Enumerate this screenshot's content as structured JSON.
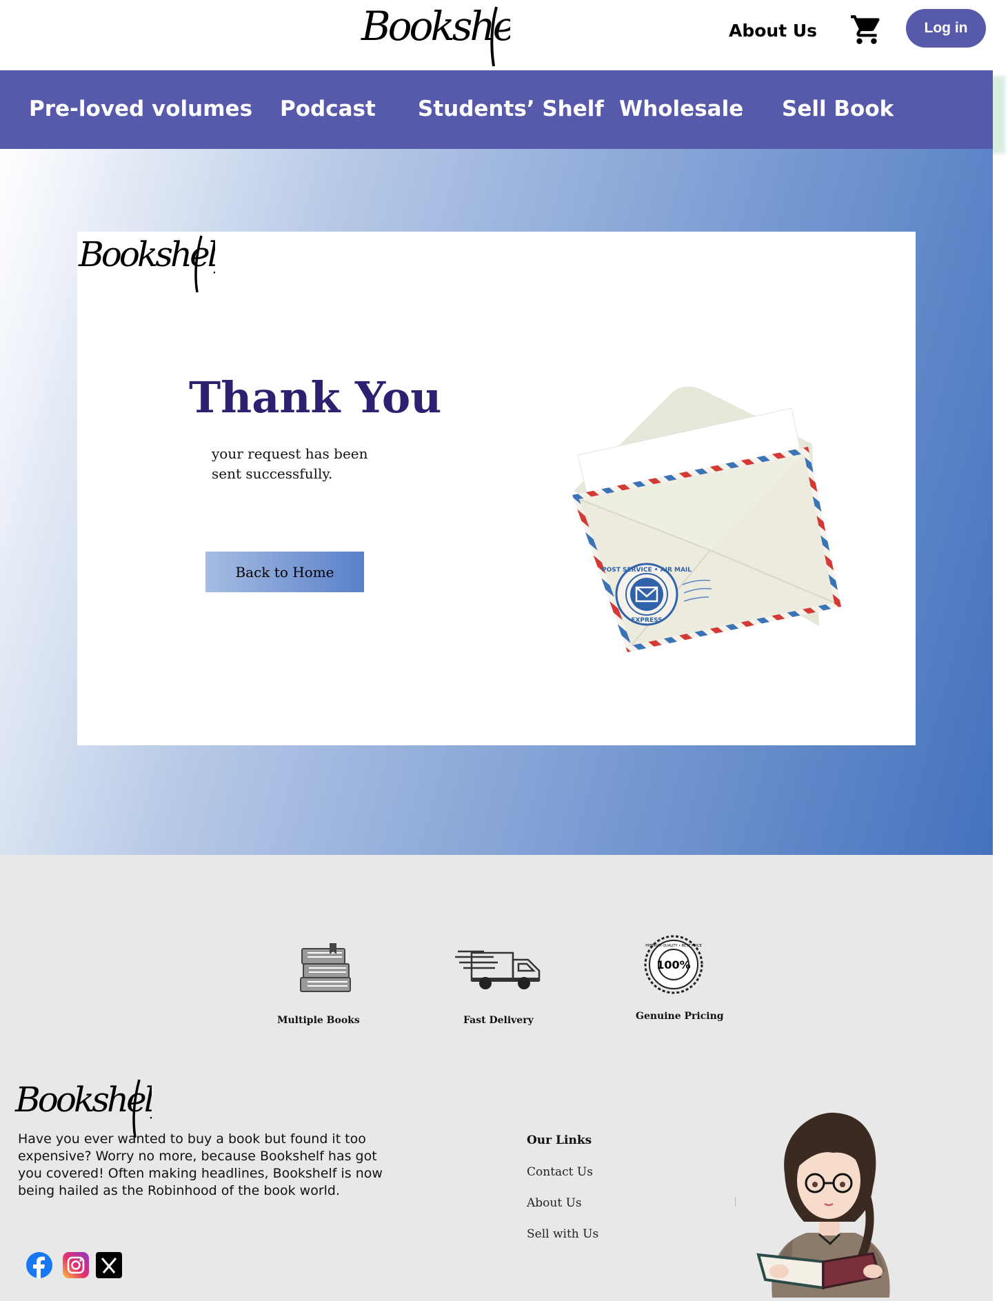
{
  "header": {
    "logo_text": "Bookshelf",
    "about_label": "About Us",
    "cart_icon": "cart-icon",
    "login_label": "Log in"
  },
  "nav": {
    "items": [
      {
        "label": "Pre-loved volumes"
      },
      {
        "label": "Podcast"
      },
      {
        "label": "Students’ Shelf"
      },
      {
        "label": "Wholesale"
      },
      {
        "label": "Sell Book"
      }
    ]
  },
  "hero": {
    "logo_text": "Bookshelf",
    "title": "Thank You",
    "message": "your request has been sent successfully.",
    "back_button": "Back to Home",
    "stamp_text_top": "POST SERVICE • AIR MAIL",
    "stamp_text_bottom": "EXPRESS"
  },
  "features": [
    {
      "icon": "books-stack-icon",
      "label": "Multiple Books"
    },
    {
      "icon": "delivery-truck-icon",
      "label": "Fast Delivery"
    },
    {
      "icon": "quality-seal-icon",
      "label": "Genuine Pricing",
      "seal_text": "100%",
      "seal_ring": "PREMIUM QUALITY • BEST PRICE"
    }
  ],
  "footer": {
    "logo_text": "Bookshelf",
    "description": "Have you ever wanted to buy a book but found it too expensive? Worry no more, because Bookshelf has got you covered! Often making headlines, Bookshelf is now being hailed as the Robinhood of the book world.",
    "links_title": "Our Links",
    "links": [
      {
        "label": "Contact Us"
      },
      {
        "label": "About Us"
      },
      {
        "label": "Sell with Us"
      }
    ],
    "social": [
      "facebook-icon",
      "instagram-icon",
      "x-icon"
    ]
  },
  "colors": {
    "brand_purple": "#575aab",
    "title_purple": "#2e2070",
    "hero_blue": "#4472bd",
    "footer_gray": "#e8e8e8"
  }
}
